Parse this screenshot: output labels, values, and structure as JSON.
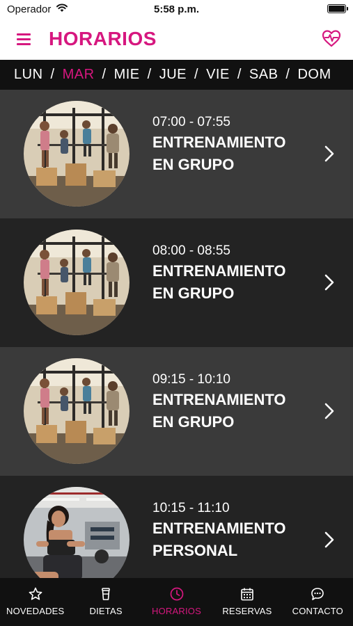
{
  "status_bar": {
    "carrier": "Operador",
    "time": "5:58 p.m."
  },
  "header": {
    "title": "HORARIOS",
    "menu_icon": "hamburger-menu-icon",
    "action_icon": "heart-pulse-icon"
  },
  "days": {
    "items": [
      "LUN",
      "MAR",
      "MIE",
      "JUE",
      "VIE",
      "SAB",
      "DOM"
    ],
    "separator": "/",
    "selected": "MAR"
  },
  "classes": [
    {
      "time": "07:00 - 07:55",
      "name_line1": "ENTRENAMIENTO",
      "name_line2": "EN GRUPO"
    },
    {
      "time": "08:00 - 08:55",
      "name_line1": "ENTRENAMIENTO",
      "name_line2": "EN GRUPO"
    },
    {
      "time": "09:15 - 10:10",
      "name_line1": "ENTRENAMIENTO",
      "name_line2": "EN GRUPO"
    },
    {
      "time": "10:15 - 11:10",
      "name_line1": "ENTRENAMIENTO",
      "name_line2": "PERSONAL"
    }
  ],
  "tab_bar": {
    "items": [
      {
        "label": "NOVEDADES",
        "icon": "star-icon"
      },
      {
        "label": "DIETAS",
        "icon": "cup-icon"
      },
      {
        "label": "HORARIOS",
        "icon": "clock-icon"
      },
      {
        "label": "RESERVAS",
        "icon": "calendar-icon"
      },
      {
        "label": "CONTACTO",
        "icon": "chat-bubble-icon"
      }
    ],
    "active": "HORARIOS"
  },
  "colors": {
    "accent": "#d6177f",
    "row_light": "#3a3a3a",
    "row_dark": "#232323",
    "bar_background": "#111111"
  }
}
